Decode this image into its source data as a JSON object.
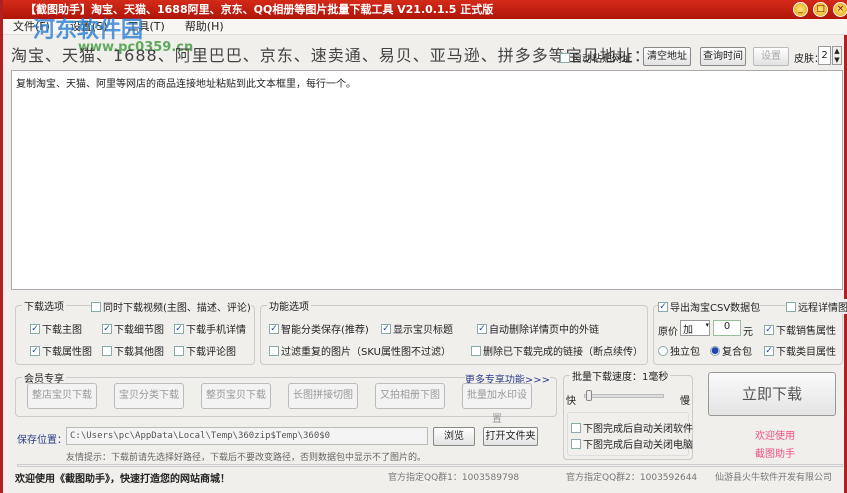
{
  "title": "【截图助手】淘宝、天猫、1688阿里、京东、QQ相册等图片批量下载工具 V21.0.1.5 正式版",
  "watermark": {
    "name": "河东软件园",
    "url": "www.pc0359.cn"
  },
  "menu": [
    "文件(F)",
    "设置(S)",
    "工具(T)",
    "帮助(H)"
  ],
  "url_label": "淘宝、天猫、1688、阿里巴巴、京东、速卖通、易贝、亚马逊、拼多多等宝贝地址：",
  "auto_paste": "自动粘贴网址",
  "clear_btn": "清空地址",
  "query_btn": "查询时间",
  "settings_btn": "设置",
  "skin_label": "皮肤：",
  "skin_value": "2",
  "textarea": "复制淘宝、天猫、阿里等网店的商品连接地址粘贴到此文本框里，每行一个。",
  "download_options": {
    "title": "下载选项",
    "video": "同时下载视频(主图、描述、评论)",
    "items": [
      {
        "label": "下载主图",
        "checked": true
      },
      {
        "label": "下载细节图",
        "checked": true
      },
      {
        "label": "下载手机详情",
        "checked": true
      },
      {
        "label": "下载属性图",
        "checked": true
      },
      {
        "label": "下载其他图",
        "checked": false
      },
      {
        "label": "下载评论图",
        "checked": false
      }
    ]
  },
  "function_options": {
    "title": "功能选项",
    "items": [
      {
        "label": "智能分类保存(推荐)",
        "checked": true
      },
      {
        "label": "显示宝贝标题",
        "checked": true
      },
      {
        "label": "自动删除详情页中的外链",
        "checked": true
      },
      {
        "label": "过滤重复的图片（SKU属性图不过滤）",
        "checked": false
      },
      {
        "label": "删除已下载完成的链接（断点续传）",
        "checked": false
      }
    ]
  },
  "csv": {
    "export": "导出淘宝CSV数据包",
    "remote": "远程详情图",
    "price_label": "原价",
    "op": "加",
    "price": "0",
    "unit": "元",
    "sales_attr": "下载销售属性",
    "single": "独立包",
    "combined": "复合包",
    "category_attr": "下载类目属性"
  },
  "member": {
    "title": "会员专享",
    "more": "更多专享功能>>>",
    "buttons": [
      "整店宝贝下载",
      "宝贝分类下载",
      "整页宝贝下载",
      "长图拼接切图",
      "又拍相册下图",
      "批量加水印设置"
    ]
  },
  "speed": {
    "title": "批量下载速度：1毫秒",
    "fast": "快",
    "slow": "慢",
    "close_app": "下图完成后自动关闭软件",
    "shutdown": "下图完成后自动关闭电脑",
    "value": 0
  },
  "download_btn": "立即下载",
  "promo": [
    "欢迎使用",
    "截图助手"
  ],
  "save": {
    "label": "保存位置：",
    "path": "C:\\Users\\pc\\AppData\\Local\\Temp\\360zip$Temp\\360$0",
    "browse": "浏览",
    "open": "打开文件夹",
    "tip": "友情提示：下载前请先选择好路径，下载后不要改变路径，否则数据包中显示不了图片的。"
  },
  "status": {
    "welcome": "欢迎使用《截图助手》，快速打造您的网站商城！",
    "qq1": "官方指定QQ群1：1003589798",
    "qq2": "官方指定QQ群2：1003592644",
    "company": "仙游县火牛软件开发有限公司"
  }
}
